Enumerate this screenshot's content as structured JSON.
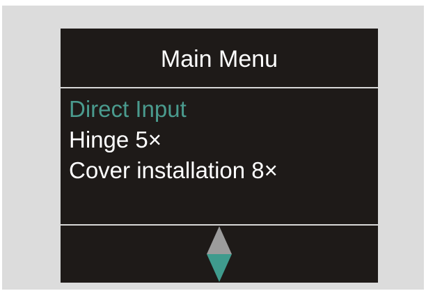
{
  "screen": {
    "title": "Main Menu",
    "menu_items": [
      {
        "label": "Direct Input",
        "selected": true
      },
      {
        "label": "Hinge 5×",
        "selected": false
      },
      {
        "label": "Cover installation 8×",
        "selected": false
      }
    ],
    "scroll_indicator": {
      "up_icon": "triangle-up-icon",
      "down_icon": "triangle-down-icon"
    }
  },
  "colors": {
    "screen_background": "#1e1a18",
    "text": "#ffffff",
    "selected_text": "#4a9b8e",
    "arrow_up": "#9c9c9c",
    "arrow_down": "#3f9b8d",
    "frame": "#dcdcdc"
  }
}
